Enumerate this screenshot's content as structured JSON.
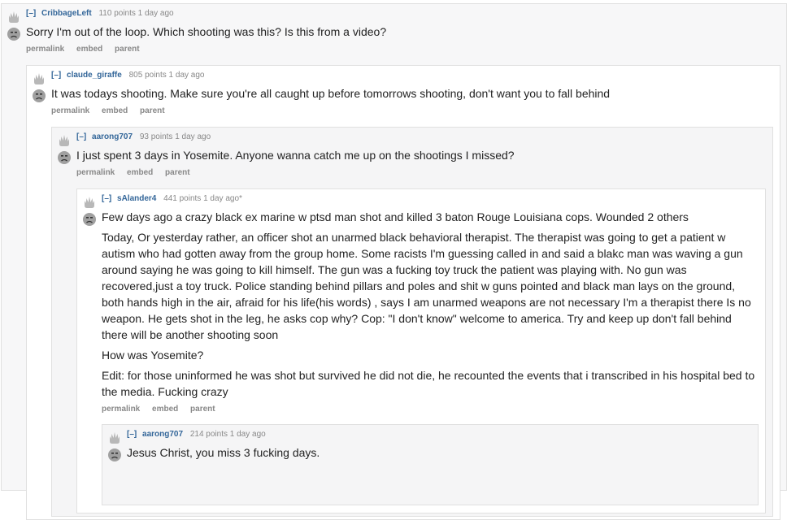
{
  "colors": {
    "author": "#336699",
    "meta": "#888888",
    "text": "#222222",
    "border": "#e0e0e0"
  },
  "icons": {
    "upvote": "flame-upvote-icon",
    "downvote": "sad-face-downvote-icon"
  },
  "comments": [
    {
      "expand": "[–]",
      "author": "CribbageLeft",
      "score": "110 points",
      "time": "1 day ago",
      "body": [
        "Sorry I'm out of the loop. Which shooting was this? Is this from a video?"
      ],
      "buttons": [
        "permalink",
        "embed",
        "parent"
      ]
    },
    {
      "expand": "[–]",
      "author": "claude_giraffe",
      "score": "805 points",
      "time": "1 day ago",
      "body": [
        "It was todays shooting. Make sure you're all caught up before tomorrows shooting, don't want you to fall behind"
      ],
      "buttons": [
        "permalink",
        "embed",
        "parent"
      ]
    },
    {
      "expand": "[–]",
      "author": "aarong707",
      "score": "93 points",
      "time": "1 day ago",
      "body": [
        "I just spent 3 days in Yosemite. Anyone wanna catch me up on the shootings I missed?"
      ],
      "buttons": [
        "permalink",
        "embed",
        "parent"
      ]
    },
    {
      "expand": "[–]",
      "author": "sAlander4",
      "score": "441 points",
      "time": "1 day ago*",
      "body": [
        "Few days ago a crazy black ex marine w ptsd man shot and killed 3 baton Rouge Louisiana cops. Wounded 2 others",
        "Today, Or yesterday rather, an officer shot an unarmed black behavioral therapist. The therapist was going to get a patient w autism who had gotten away from the group home. Some racists I'm guessing called in and said a blakc man was waving a gun around saying he was going to kill himself. The gun was a fucking toy truck the patient was playing with. No gun was recovered,just a toy truck. Police standing behind pillars and poles and shit w guns pointed and black man lays on the ground, both hands high in the air, afraid for his life(his words) , says I am unarmed weapons are not necessary I'm a therapist there Is no weapon. He gets shot in the leg, he asks cop why? Cop: \"I don't know\" welcome to america. Try and keep up don't fall behind there will be another shooting soon",
        "How was Yosemite?",
        "Edit: for those uninformed he was shot but survived he did not die, he recounted the events that i transcribed in his hospital bed to the media. Fucking crazy"
      ],
      "buttons": [
        "permalink",
        "embed",
        "parent"
      ]
    },
    {
      "expand": "[–]",
      "author": "aarong707",
      "score": "214 points",
      "time": "1 day ago",
      "body": [
        "Jesus Christ, you miss 3 fucking days."
      ],
      "buttons": []
    }
  ]
}
